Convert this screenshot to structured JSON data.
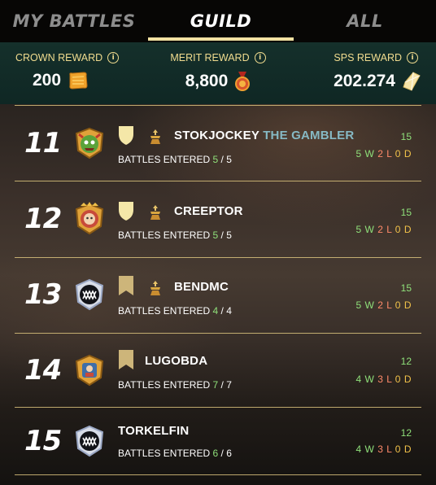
{
  "tabs": [
    {
      "label": "MY BATTLES",
      "active": false
    },
    {
      "label": "GUILD",
      "active": true
    },
    {
      "label": "ALL",
      "active": false
    }
  ],
  "rewards": {
    "crown": {
      "label": "CROWN REWARD",
      "value": "200",
      "icon": "crown-token-icon"
    },
    "merit": {
      "label": "MERIT REWARD",
      "value": "8,800",
      "icon": "merit-medal-icon"
    },
    "sps": {
      "label": "SPS REWARD",
      "value": "202.274",
      "icon": "sps-crystal-icon"
    }
  },
  "info_glyph": "i",
  "rows": [
    {
      "rank": "11",
      "avatar": "orc-guild-avatar",
      "badge": "shield-badge",
      "mini": true,
      "name": "STOKJOCKEY",
      "title": "THE GAMBLER",
      "battles_label": "BATTLES ENTERED",
      "battles_entered": "5",
      "battles_sep": "/",
      "battles_total": "5",
      "score": "15",
      "wins": "5",
      "wins_unit": "W",
      "losses": "2",
      "losses_unit": "L",
      "draws": "0",
      "draws_unit": "D"
    },
    {
      "rank": "12",
      "avatar": "king-guild-avatar",
      "badge": "shield-badge",
      "mini": true,
      "name": "CREEPTOR",
      "title": "",
      "battles_label": "BATTLES ENTERED",
      "battles_entered": "5",
      "battles_sep": "/",
      "battles_total": "5",
      "score": "15",
      "wins": "5",
      "wins_unit": "W",
      "losses": "2",
      "losses_unit": "L",
      "draws": "0",
      "draws_unit": "D"
    },
    {
      "rank": "13",
      "avatar": "monster-mouth-avatar",
      "badge": "banner-badge",
      "mini": true,
      "name": "BENDMC",
      "title": "",
      "battles_label": "BATTLES ENTERED",
      "battles_entered": "4",
      "battles_sep": "/",
      "battles_total": "4",
      "score": "15",
      "wins": "5",
      "wins_unit": "W",
      "losses": "2",
      "losses_unit": "L",
      "draws": "0",
      "draws_unit": "D"
    },
    {
      "rank": "14",
      "avatar": "shield-guild-avatar",
      "badge": "banner-badge",
      "mini": false,
      "name": "LUGOBDA",
      "title": "",
      "battles_label": "BATTLES ENTERED",
      "battles_entered": "7",
      "battles_sep": "/",
      "battles_total": "7",
      "score": "12",
      "wins": "4",
      "wins_unit": "W",
      "losses": "3",
      "losses_unit": "L",
      "draws": "0",
      "draws_unit": "D"
    },
    {
      "rank": "15",
      "avatar": "monster-mouth-avatar",
      "badge": "",
      "mini": false,
      "name": "TORKELFIN",
      "title": "",
      "battles_label": "BATTLES ENTERED",
      "battles_entered": "6",
      "battles_sep": "/",
      "battles_total": "6",
      "score": "12",
      "wins": "4",
      "wins_unit": "W",
      "losses": "3",
      "losses_unit": "L",
      "draws": "0",
      "draws_unit": "D"
    }
  ]
}
